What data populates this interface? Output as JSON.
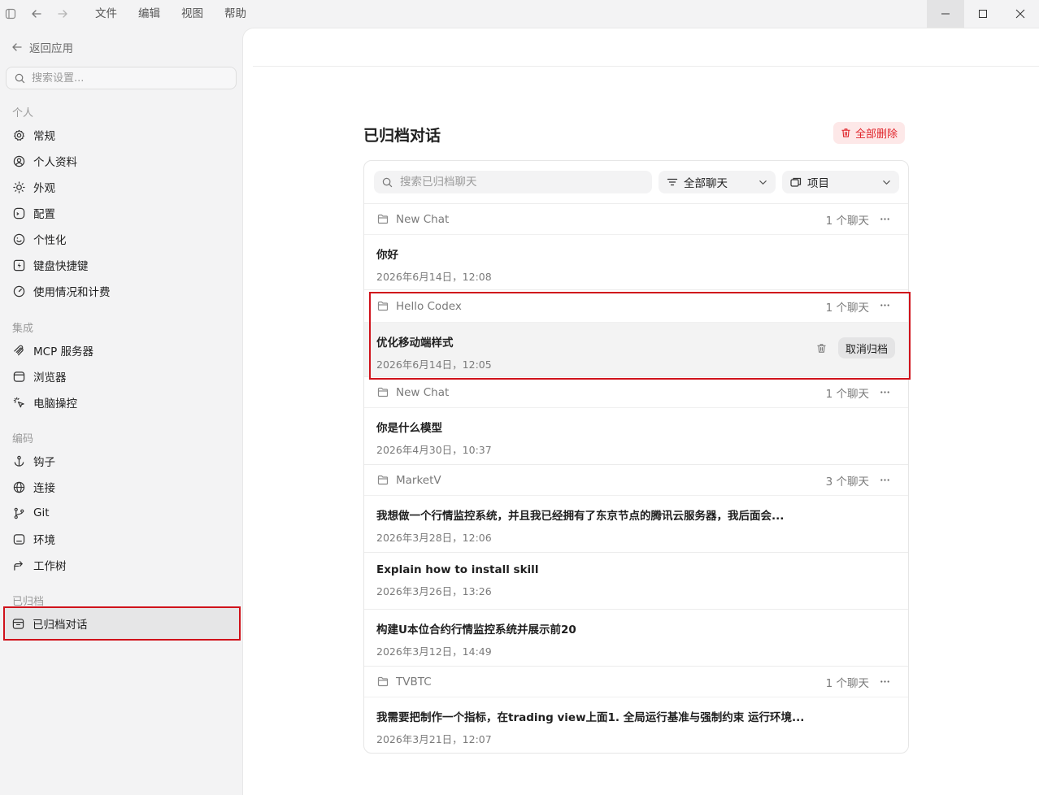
{
  "menu": [
    "文件",
    "编辑",
    "视图",
    "帮助"
  ],
  "sidebar": {
    "back_label": "返回应用",
    "search_placeholder": "搜索设置...",
    "sections": {
      "personal": "个人",
      "integration": "集成",
      "coding": "编码",
      "archived": "已归档"
    },
    "items": {
      "general": "常规",
      "profile": "个人资料",
      "appearance": "外观",
      "config": "配置",
      "personalization": "个性化",
      "shortcuts": "键盘快捷键",
      "usage": "使用情况和计费",
      "mcp": "MCP 服务器",
      "browser": "浏览器",
      "computer": "电脑操控",
      "hooks": "钩子",
      "connections": "连接",
      "git": "Git",
      "env": "环境",
      "worktree": "工作树",
      "archived_chats": "已归档对话"
    }
  },
  "main": {
    "title": "已归档对话",
    "delete_all": "全部删除",
    "search_placeholder": "搜索已归档聊天",
    "filter_label": "全部聊天",
    "project_label": "项目",
    "unarchive": "取消归档",
    "groups": [
      {
        "name": "New Chat",
        "count": "1 个聊天",
        "chats": [
          {
            "title": "你好",
            "date": "2026年6月14日，12:08"
          }
        ]
      },
      {
        "name": "Hello Codex",
        "count": "1 个聊天",
        "chats": [
          {
            "title": "优化移动端样式",
            "date": "2026年6月14日，12:05"
          }
        ]
      },
      {
        "name": "New Chat",
        "count": "1 个聊天",
        "chats": [
          {
            "title": "你是什么模型",
            "date": "2026年4月30日，10:37"
          }
        ]
      },
      {
        "name": "MarketV",
        "count": "3 个聊天",
        "chats": [
          {
            "title": "我想做一个行情监控系统，并且我已经拥有了东京节点的腾讯云服务器，我后面会...",
            "date": "2026年3月28日，12:06"
          },
          {
            "title": "Explain how to install skill",
            "date": "2026年3月26日，13:26"
          },
          {
            "title": "构建U本位合约行情监控系统并展示前20",
            "date": "2026年3月12日，14:49"
          }
        ]
      },
      {
        "name": "TVBTC",
        "count": "1 个聊天",
        "chats": [
          {
            "title": "我需要把制作一个指标，在trading view上面1. 全局运行基准与强制约束 运行环境...",
            "date": "2026年3月21日，12:07"
          }
        ]
      }
    ]
  }
}
